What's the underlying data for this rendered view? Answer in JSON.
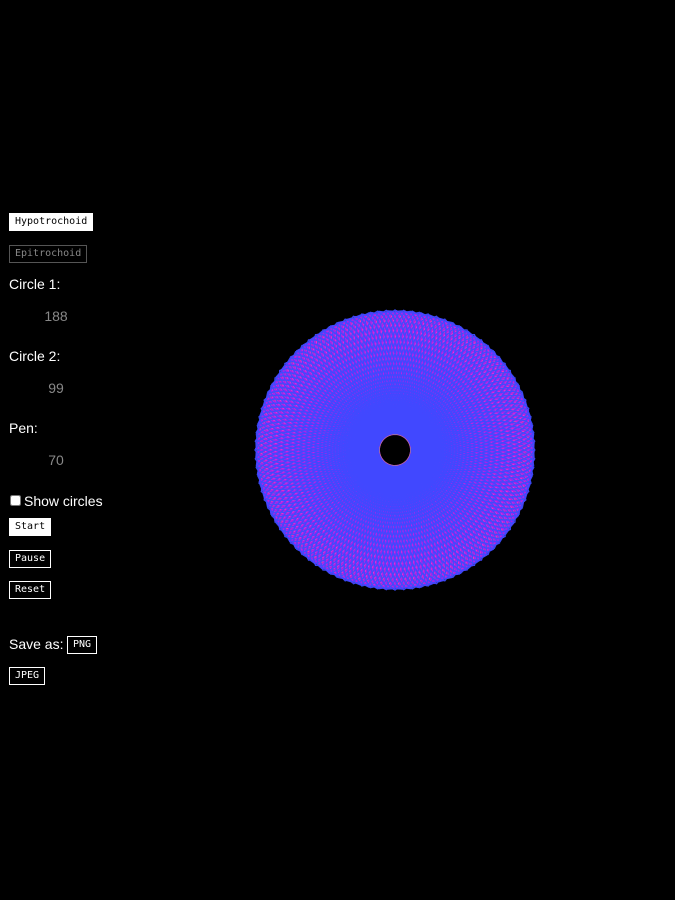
{
  "mode_buttons": {
    "hypotrochoid": "Hypotrochoid",
    "epitrochoid": "Epitrochoid"
  },
  "fields": {
    "circle1": {
      "label": "Circle 1:",
      "value": "188"
    },
    "circle2": {
      "label": "Circle 2:",
      "value": "99"
    },
    "pen": {
      "label": "Pen:",
      "value": "70"
    }
  },
  "show_circles": {
    "label": "Show circles",
    "checked": false
  },
  "actions": {
    "start": "Start",
    "pause": "Pause",
    "reset": "Reset"
  },
  "save": {
    "label": "Save as:",
    "png": "PNG",
    "jpeg": "JPEG"
  },
  "spiro": {
    "mode": "hypotrochoid",
    "R": 188,
    "r": 99,
    "d": 70,
    "background": "#000000",
    "palette": [
      "#3b4bff",
      "#a020f0",
      "#ff2bd6",
      "#ff5a3c",
      "#ffd21e",
      "#7dff2e"
    ]
  }
}
